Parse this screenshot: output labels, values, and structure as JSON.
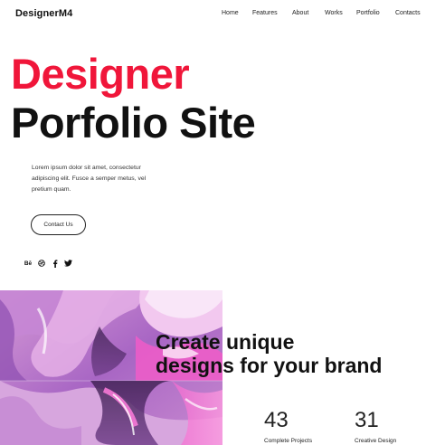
{
  "header": {
    "logo": "DesignerM4",
    "nav": [
      "Home",
      "Features",
      "About",
      "Works",
      "Portfolio",
      "Contacts"
    ]
  },
  "hero": {
    "title_line1": "Designer",
    "title_line2": "Porfolio Site",
    "description": "Lorem ipsum dolor sit amet, consectetur adipiscing elit. Fusce a semper metus, vel pretium quam.",
    "contact_button": "Contact Us",
    "socials": [
      {
        "name": "behance-icon",
        "glyph": "Bē"
      },
      {
        "name": "dribbble-icon",
        "glyph": "◎"
      },
      {
        "name": "facebook-icon",
        "glyph": "f"
      },
      {
        "name": "twitter-icon",
        "glyph": "🐦"
      }
    ]
  },
  "promo": {
    "tagline_line1": "Create unique",
    "tagline_line2": "designs for your brand"
  },
  "stats": [
    {
      "value": "43",
      "label": "Complete Projects"
    },
    {
      "value": "31",
      "label": "Creative Design"
    }
  ],
  "colors": {
    "accent": "#f0163a",
    "text": "#111111",
    "art_base": "#b977c4"
  }
}
